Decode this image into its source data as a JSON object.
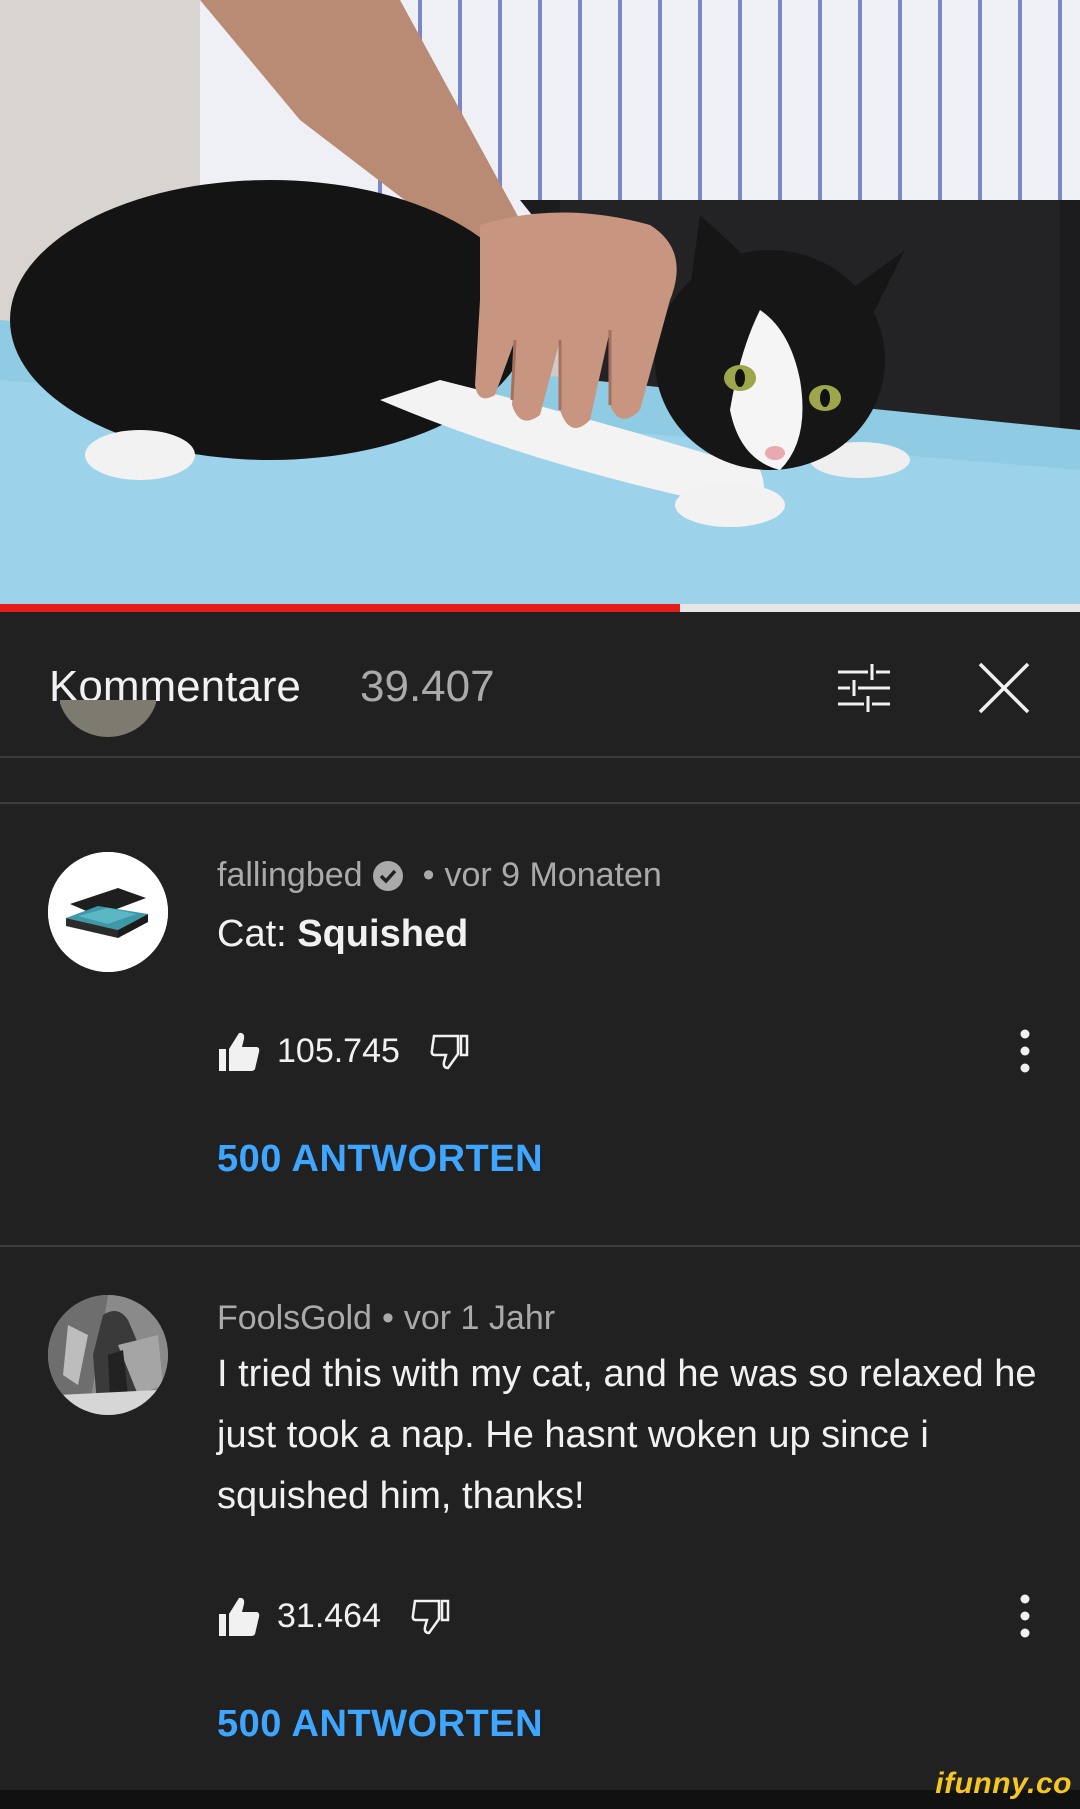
{
  "colors": {
    "background": "#212121",
    "text_primary": "#f1f1f1",
    "text_secondary": "#aaaaaa",
    "link_blue": "#3ea6ff",
    "progress_red": "#e51c17",
    "watermark_yellow": "#f6c623"
  },
  "video": {
    "progress_fraction": 0.63
  },
  "header": {
    "title": "Kommentare",
    "count": "39.407",
    "sort_icon": "sort-filter-icon",
    "close_icon": "close-icon"
  },
  "comments": [
    {
      "author": "fallingbed",
      "verified": true,
      "separator": "•",
      "time": "vor 9 Monaten",
      "text_prefix": "Cat: ",
      "text_bold": "Squished",
      "likes": "105.745",
      "replies": "500 ANTWORTEN"
    },
    {
      "author": "FoolsGold",
      "verified": false,
      "separator": "•",
      "time": "vor 1 Jahr",
      "text": "I tried this with my cat, and he was so relaxed he just took a nap. He hasnt woken up since i squished him, thanks!",
      "likes": "31.464",
      "replies": "500 ANTWORTEN"
    }
  ],
  "watermark": "ifunny.co"
}
